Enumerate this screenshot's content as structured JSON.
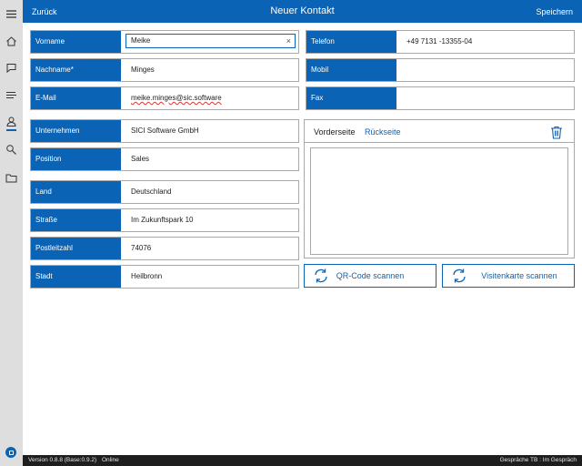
{
  "topbar": {
    "back_label": "Zurück",
    "title": "Neuer Kontakt",
    "save_label": "Speichern"
  },
  "rail": {
    "icons": [
      "menu-icon",
      "home-icon",
      "chat-icon",
      "list-icon",
      "contact-icon",
      "search-icon",
      "folder-icon"
    ],
    "active": "contact-icon"
  },
  "form": {
    "vorname": {
      "label": "Vorname",
      "value": "Meike",
      "clear": "×"
    },
    "nachname": {
      "label": "Nachname*",
      "value": "Minges"
    },
    "email": {
      "label": "E-Mail",
      "value": "meike.minges@sic.software"
    },
    "telefon": {
      "label": "Telefon",
      "value": "+49 7131 -13355-04"
    },
    "mobil": {
      "label": "Mobil",
      "value": ""
    },
    "fax": {
      "label": "Fax",
      "value": ""
    },
    "unternehmen": {
      "label": "Unternehmen",
      "value": "SICI Software GmbH"
    },
    "position": {
      "label": "Position",
      "value": "Sales"
    },
    "land": {
      "label": "Land",
      "value": "Deutschland"
    },
    "strasse": {
      "label": "Straße",
      "value": "Im Zukunftspark 10"
    },
    "plz": {
      "label": "Postleitzahl",
      "value": "74076"
    },
    "stadt": {
      "label": "Stadt",
      "value": "Heilbronn"
    }
  },
  "card": {
    "tab_front": "Vorderseite",
    "tab_back": "Rückseite"
  },
  "buttons": {
    "qr": "QR-Code scannen",
    "card": "Visitenkarte scannen"
  },
  "status": {
    "version": "Version 0.8.8 (Base:0.9.2)",
    "online": "Online",
    "session": "Gespräche TB : Im Gespräch"
  },
  "colors": {
    "accent": "#0a63b5",
    "rail": "#dedede",
    "status_bar": "#1e1e1e"
  }
}
